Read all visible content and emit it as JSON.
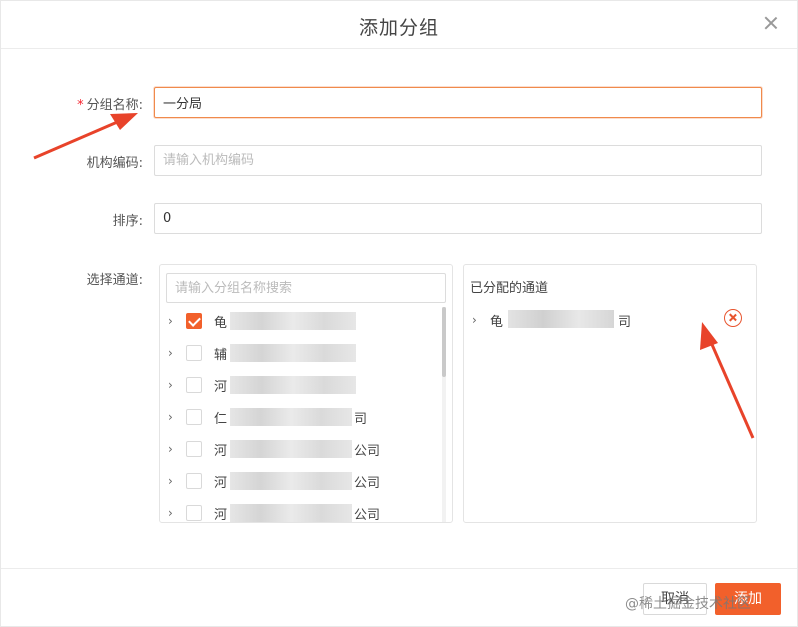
{
  "dialog": {
    "title": "添加分组"
  },
  "form": {
    "group_name": {
      "required_mark": "*",
      "label": "分组名称:",
      "value": "一分局"
    },
    "org_code": {
      "label": "机构编码:",
      "placeholder": "请输入机构编码",
      "value": ""
    },
    "sort": {
      "label": "排序:",
      "value": "0"
    },
    "channel": {
      "label": "选择通道:"
    }
  },
  "left_panel": {
    "search_placeholder": "请输入分组名称搜索",
    "items": [
      {
        "prefix": "龟",
        "suffix": "",
        "checked": true
      },
      {
        "prefix": "辅",
        "suffix": "",
        "checked": false
      },
      {
        "prefix": "河",
        "suffix": "",
        "checked": false
      },
      {
        "prefix": "仁",
        "suffix": "司",
        "checked": false
      },
      {
        "prefix": "河",
        "suffix": "公司",
        "checked": false
      },
      {
        "prefix": "河",
        "suffix": "公司",
        "checked": false
      },
      {
        "prefix": "河",
        "suffix": "公司",
        "checked": false
      }
    ]
  },
  "right_panel": {
    "title": "已分配的通道",
    "items": [
      {
        "prefix": "龟",
        "suffix": "司"
      }
    ]
  },
  "footer": {
    "cancel_label": "取消",
    "ok_label": "添加",
    "watermark": "@稀土掘金技术社区"
  },
  "colors": {
    "accent": "#f2602b",
    "focus_border": "#f08a4b",
    "arrow": "#e8432a"
  }
}
